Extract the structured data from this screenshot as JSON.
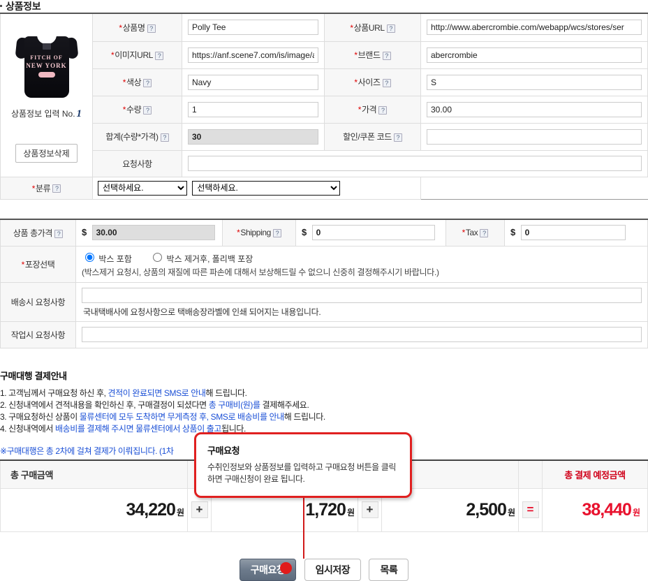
{
  "section": {
    "title": "상품정보"
  },
  "product": {
    "photo_label": "상품정보 입력 No.",
    "photo_number": "1",
    "delete_button": "상품정보삭제",
    "shirt_graphic_line1": "FITCH OF",
    "shirt_graphic_line2": "NEW YORK",
    "fields": {
      "name_label": "상품명",
      "name_value": "Polly Tee",
      "url_label": "상품URL",
      "url_value": "http://www.abercrombie.com/webapp/wcs/stores/ser",
      "image_url_label": "이미지URL",
      "image_url_value": "https://anf.scene7.com/is/image/ar",
      "brand_label": "브랜드",
      "brand_value": "abercrombie",
      "color_label": "색상",
      "color_value": "Navy",
      "size_label": "사이즈",
      "size_value": "S",
      "qty_label": "수량",
      "qty_value": "1",
      "price_label": "가격",
      "price_value": "30.00",
      "subtotal_label": "합계(수량*가격)",
      "subtotal_value": "30",
      "coupon_label": "할인/쿠폰 코드",
      "coupon_value": "",
      "request_label": "요청사항",
      "request_value": "",
      "category_label": "분류",
      "category1_value": "선택하세요.",
      "category2_value": "선택하세요."
    }
  },
  "pricing": {
    "total_price_label": "상품 총가격",
    "total_price_value": "30.00",
    "shipping_label": "Shipping",
    "shipping_value": "0",
    "tax_label": "Tax",
    "tax_value": "0",
    "currency_symbol": "$",
    "packaging_label": "포장선택",
    "packaging_option1": "박스 포함",
    "packaging_option2": "박스 제거후, 폴리백 포장",
    "packaging_note": "(박스제거 요청시, 상품의 재질에 따른 파손에 대해서 보상해드릴 수 없으니 신중히 결정해주시기 바랍니다.)",
    "delivery_request_label": "배송시 요청사항",
    "delivery_request_value": "",
    "delivery_request_hint": "국내택배사에 요청사항으로 택배송장라벨에 인쇄 되어지는 내용입니다.",
    "work_request_label": "작업시 요청사항",
    "work_request_value": ""
  },
  "guide": {
    "title": "구매대행 결제안내",
    "items": [
      {
        "num": "1.",
        "a": "고객님께서 구매요청 하신 후, ",
        "hl": "견적이 완료되면 SMS로 안내",
        "b": "해 드립니다."
      },
      {
        "num": "2.",
        "a": "신청내역에서 견적내용을 확인하신 후, 구매결정이 되셨다면 ",
        "hl": "총 구매비(원)를",
        "b": " 결제해주세요."
      },
      {
        "num": "3.",
        "a": "구매요청하신 상품이 ",
        "hl": "물류센터에 모두 도착하면 무게측정 후, SMS로 배송비를 안내",
        "b": "해 드립니다."
      },
      {
        "num": "4.",
        "a": "신청내역에서 ",
        "hl": "배송비를 결제해 주시면 물류센터에서 상품이 출고",
        "b": "됩니다."
      }
    ],
    "note": "※구매대행은 총 2차에 걸쳐 결제가 이뤄집니다. (1차"
  },
  "callout": {
    "title": "구매요청",
    "body": "수취인정보와 상품정보를 입력하고 구매요청 버튼을 클릭하면 구매신청이 완료 됩니다."
  },
  "totals": {
    "headers": [
      "총 구매금액",
      "",
      "",
      "총 결제 예정금액"
    ],
    "header_purchase": "총 구매금액",
    "header_final": "총 결제 예정금액",
    "values": [
      "34,220",
      "1,720",
      "2,500",
      "38,440"
    ],
    "won": "원",
    "op_plus": "+",
    "op_equals": "=",
    "final_color": "#e8112d"
  },
  "actions": {
    "primary": "구매요청",
    "temp_save": "임시저장",
    "list": "목록"
  },
  "icons": {
    "help": "?"
  }
}
